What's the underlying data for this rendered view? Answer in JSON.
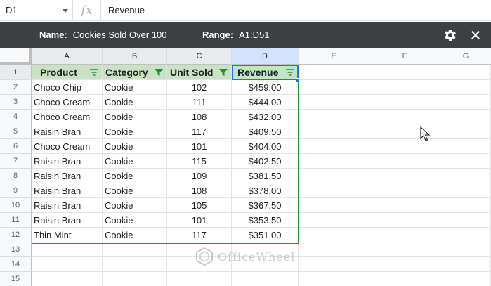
{
  "formula_bar": {
    "cell_ref": "D1",
    "fx": "fx",
    "value": "Revenue"
  },
  "filter_view": {
    "name_label": "Name:",
    "name_value": "Cookies Sold Over 100",
    "range_label": "Range:",
    "range_value": "A1:D51"
  },
  "columns": [
    "A",
    "B",
    "C",
    "D",
    "E",
    "F",
    "G"
  ],
  "rows": [
    "1",
    "2",
    "3",
    "4",
    "5",
    "6",
    "7",
    "8",
    "9",
    "10",
    "11",
    "12",
    "13",
    "14",
    "15"
  ],
  "table": {
    "headers": [
      "Product",
      "Category",
      "Unit Sold",
      "Revenue"
    ],
    "data": [
      [
        "Choco Chip",
        "Cookie",
        "102",
        "$459.00"
      ],
      [
        "Choco Cream",
        "Cookie",
        "111",
        "$444.00"
      ],
      [
        "Choco Cream",
        "Cookie",
        "108",
        "$432.00"
      ],
      [
        "Raisin Bran",
        "Cookie",
        "117",
        "$409.50"
      ],
      [
        "Choco Cream",
        "Cookie",
        "101",
        "$404.00"
      ],
      [
        "Raisin Bran",
        "Cookie",
        "115",
        "$402.50"
      ],
      [
        "Raisin Bran",
        "Cookie",
        "109",
        "$381.50"
      ],
      [
        "Raisin Bran",
        "Cookie",
        "108",
        "$378.00"
      ],
      [
        "Raisin Bran",
        "Cookie",
        "105",
        "$367.50"
      ],
      [
        "Raisin Bran",
        "Cookie",
        "101",
        "$353.50"
      ],
      [
        "Thin Mint",
        "Cookie",
        "117",
        "$351.00"
      ]
    ]
  },
  "watermark": "OfficeWheel",
  "colors": {
    "filter_bar_bg": "#3c4043",
    "header_fill": "#c9e2c3",
    "filter_border": "#1e8e3e",
    "selection": "#1a73e8"
  },
  "icons": {
    "settings": "gear-icon",
    "close": "close-icon",
    "filter_active": "filter-funnel-icon",
    "filter_inactive": "filter-lines-icon"
  }
}
